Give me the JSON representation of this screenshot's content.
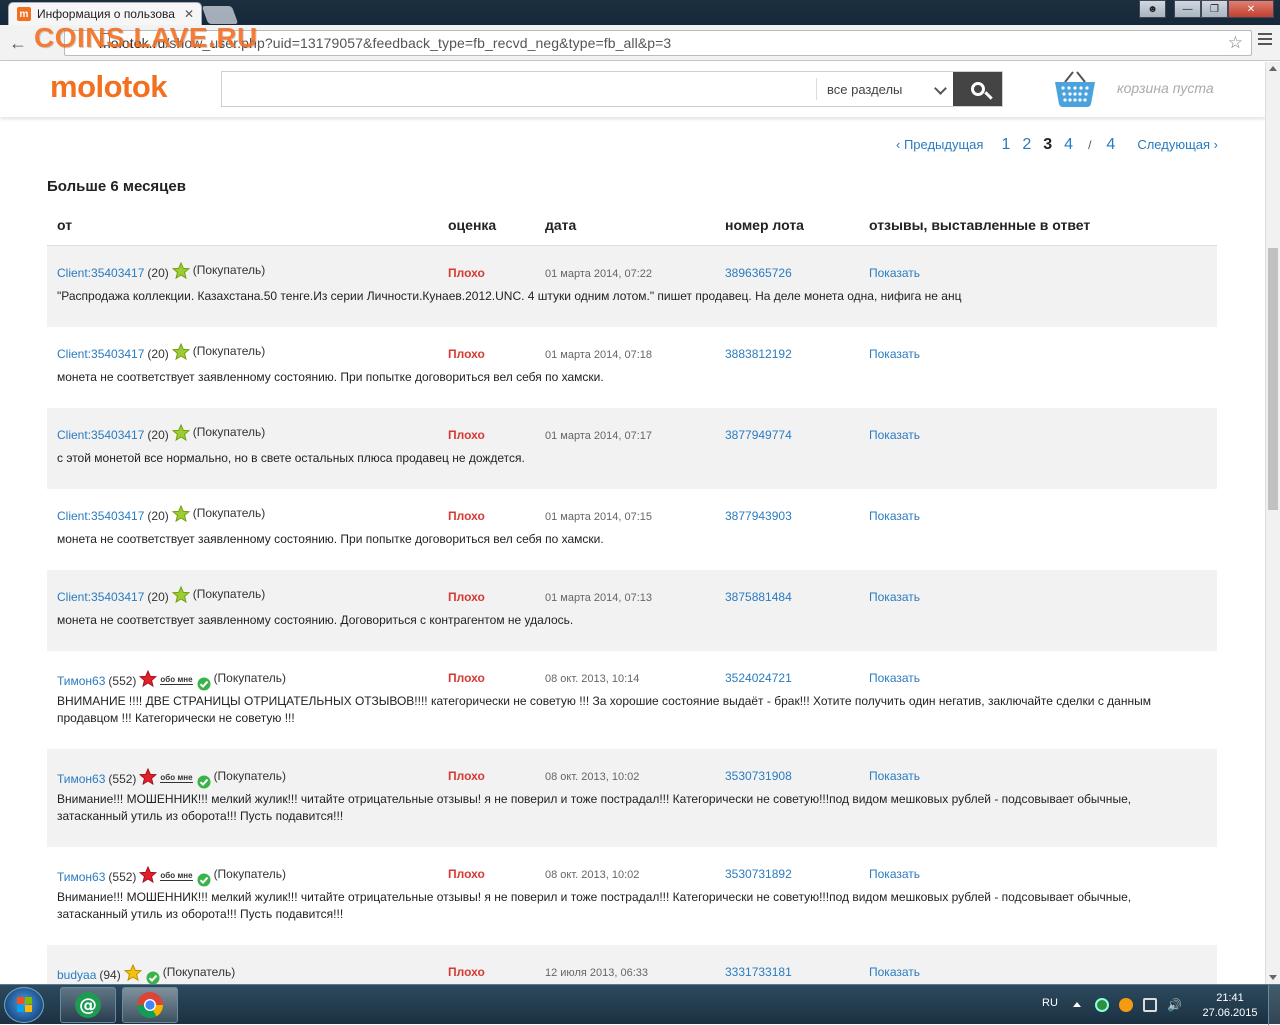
{
  "browser": {
    "tab_title": "Информация о пользова",
    "url_host": "molotok.ru",
    "url_path": "/show_user.php?uid=13179057&feedback_type=fb_recvd_neg&type=fb_all&p=3",
    "watermark": "COINS.LAVE.RU"
  },
  "site": {
    "logo": "molotok",
    "search_placeholder": "",
    "category_label": "все разделы",
    "cart_label": "корзина пуста",
    "accent_color": "#f37020",
    "link_color": "#2a7bc0",
    "negative_color": "#d43a32"
  },
  "pagination": {
    "prev": "Предыдущая",
    "pages": [
      "1",
      "2",
      "3",
      "4"
    ],
    "current": "3",
    "separator": "/",
    "total": "4",
    "next": "Следующая"
  },
  "section_title": "Больше 6 месяцев",
  "columns": {
    "from": "от",
    "rating": "оценка",
    "date": "дата",
    "lot": "номер лота",
    "responses": "отзывы, выставленные в ответ"
  },
  "rows": [
    {
      "user": "Client:35403417",
      "count": "(20)",
      "star": "green",
      "about": "",
      "role": "(Покупатель)",
      "rating": "Плохо",
      "date": "01 марта 2014, 07:22",
      "lot": "3896365726",
      "show": "Показать",
      "comment": "\"Распродажа коллекции. Казахстана.50 тенге.Из серии Личности.Кунаев.2012.UNC. 4 штуки одним лотом.\" пишет продавец. На деле монета одна, нифига не анц"
    },
    {
      "user": "Client:35403417",
      "count": "(20)",
      "star": "green",
      "about": "",
      "role": "(Покупатель)",
      "rating": "Плохо",
      "date": "01 марта 2014, 07:18",
      "lot": "3883812192",
      "show": "Показать",
      "comment": "монета не соответствует заявленному состоянию. При попытке договориться вел себя по хамски."
    },
    {
      "user": "Client:35403417",
      "count": "(20)",
      "star": "green",
      "about": "",
      "role": "(Покупатель)",
      "rating": "Плохо",
      "date": "01 марта 2014, 07:17",
      "lot": "3877949774",
      "show": "Показать",
      "comment": "с этой монетой все нормально, но в свете остальных плюса продавец не дождется."
    },
    {
      "user": "Client:35403417",
      "count": "(20)",
      "star": "green",
      "about": "",
      "role": "(Покупатель)",
      "rating": "Плохо",
      "date": "01 марта 2014, 07:15",
      "lot": "3877943903",
      "show": "Показать",
      "comment": "монета не соответствует заявленному состоянию. При попытке договориться вел себя по хамски."
    },
    {
      "user": "Client:35403417",
      "count": "(20)",
      "star": "green",
      "about": "",
      "role": "(Покупатель)",
      "rating": "Плохо",
      "date": "01 марта 2014, 07:13",
      "lot": "3875881484",
      "show": "Показать",
      "comment": "монета не соответствует заявленному состоянию. Договориться с контрагентом не удалось."
    },
    {
      "user": "Тимон63",
      "count": "(552)",
      "star": "red",
      "about": "обо мне",
      "role": "(Покупатель)",
      "rating": "Плохо",
      "date": "08 окт. 2013, 10:14",
      "lot": "3524024721",
      "show": "Показать",
      "comment": "ВНИМАНИЕ !!!! ДВЕ СТРАНИЦЫ ОТРИЦАТЕЛЬНЫХ ОТЗЫВОВ!!!! категорически не советую !!! За хорошие состояние выдаёт - брак!!! Хотите получить один негатив, заключайте сделки с данным продавцом !!! Категорически не советую !!!"
    },
    {
      "user": "Тимон63",
      "count": "(552)",
      "star": "red",
      "about": "обо мне",
      "role": "(Покупатель)",
      "rating": "Плохо",
      "date": "08 окт. 2013, 10:02",
      "lot": "3530731908",
      "show": "Показать",
      "comment": "Внимание!!! МОШЕННИК!!! мелкий жулик!!! читайте отрицательные отзывы! я не поверил и тоже пострадал!!! Категорически не советую!!!под видом мешковых рублей - подсовывает обычные, затасканный утиль из оборота!!! Пусть подавится!!!"
    },
    {
      "user": "Тимон63",
      "count": "(552)",
      "star": "red",
      "about": "обо мне",
      "role": "(Покупатель)",
      "rating": "Плохо",
      "date": "08 окт. 2013, 10:02",
      "lot": "3530731892",
      "show": "Показать",
      "comment": "Внимание!!! МОШЕННИК!!! мелкий жулик!!! читайте отрицательные отзывы! я не поверил и тоже пострадал!!! Категорически не советую!!!под видом мешковых рублей - подсовывает обычные, затасканный утиль из оборота!!! Пусть подавится!!!"
    },
    {
      "user": "budyaa",
      "count": "(94)",
      "star": "yellow",
      "about": "",
      "role": "(Покупатель)",
      "rating": "Плохо",
      "date": "12 июля 2013, 06:33",
      "lot": "3331733181",
      "show": "Показать",
      "comment": ""
    }
  ],
  "taskbar": {
    "lang": "RU",
    "time": "21:41",
    "date": "27.06.2015"
  }
}
